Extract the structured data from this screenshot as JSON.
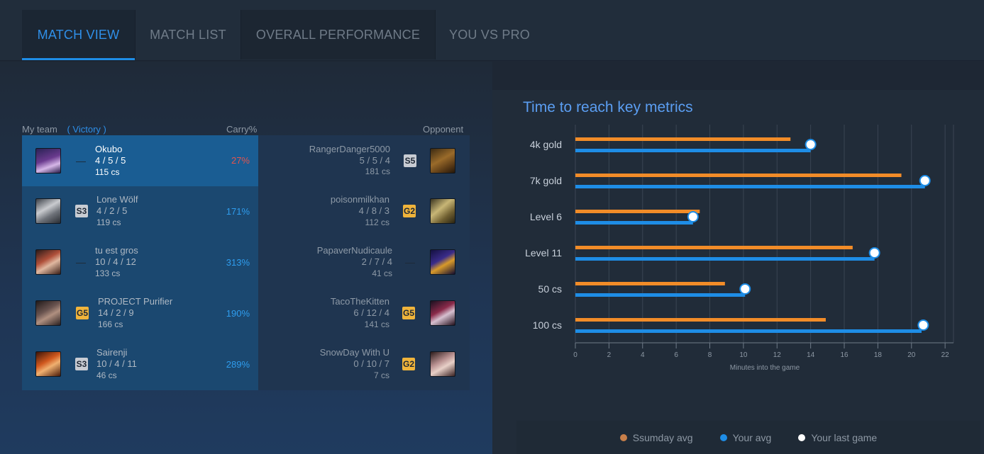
{
  "tabs": [
    {
      "label": "MATCH VIEW",
      "active": true
    },
    {
      "label": "MATCH LIST",
      "active": false
    },
    {
      "label": "OVERALL PERFORMANCE",
      "active": false
    },
    {
      "label": "YOU VS PRO",
      "active": false
    }
  ],
  "team": {
    "my_team_label": "My team",
    "result_label": "( Victory )",
    "carry_label": "Carry%",
    "opponent_label": "Opponent"
  },
  "rows": [
    {
      "me": {
        "name": "Okubo",
        "kda": "4 / 5 / 5",
        "cs": "115 cs",
        "rank": "—",
        "carry": "27%",
        "champion_icon": "champion-portrait-purple"
      },
      "opp": {
        "name": "RangerDanger5000",
        "kda": "5 / 5 / 4",
        "cs": "181 cs",
        "rank": "S5",
        "champion_icon": "champion-portrait-bronze"
      }
    },
    {
      "me": {
        "name": "Lone Wölf",
        "kda": "4 / 2 / 5",
        "cs": "119 cs",
        "rank": "S3",
        "carry": "171%",
        "champion_icon": "champion-portrait-white"
      },
      "opp": {
        "name": "poisonmilkhan",
        "kda": "4 / 8 / 3",
        "cs": "112 cs",
        "rank": "G2",
        "champion_icon": "champion-portrait-gold"
      }
    },
    {
      "me": {
        "name": "tu est gros",
        "kda": "10 / 4 / 12",
        "cs": "133 cs",
        "rank": "—",
        "carry": "313%",
        "champion_icon": "champion-portrait-red"
      },
      "opp": {
        "name": "PapaverNudicaule",
        "kda": "2 / 7 / 4",
        "cs": "41 cs",
        "rank": "—",
        "champion_icon": "champion-portrait-violet"
      }
    },
    {
      "me": {
        "name": "PROJECT Purifier",
        "kda": "14 / 2 / 9",
        "cs": "166 cs",
        "rank": "G5",
        "carry": "190%",
        "champion_icon": "champion-portrait-dark"
      },
      "opp": {
        "name": "TacoTheKitten",
        "kda": "6 / 12 / 4",
        "cs": "141 cs",
        "rank": "G5",
        "champion_icon": "champion-portrait-mask"
      }
    },
    {
      "me": {
        "name": "Sairenji",
        "kda": "10 / 4 / 11",
        "cs": "46 cs",
        "rank": "S3",
        "carry": "289%",
        "champion_icon": "champion-portrait-orange"
      },
      "opp": {
        "name": "SnowDay With U",
        "kda": "0 / 10 / 7",
        "cs": "7 cs",
        "rank": "G2",
        "champion_icon": "champion-portrait-pale"
      }
    }
  ],
  "chart": {
    "title": "Time to reach key metrics",
    "legend": [
      {
        "label": "Ssumday avg",
        "color": "#c87f4a"
      },
      {
        "label": "Your avg",
        "color": "#1e8de6"
      },
      {
        "label": "Your last game",
        "color": "#ffffff"
      }
    ]
  },
  "colors": {
    "accent": "#1e8de6",
    "orange": "#f28c28",
    "gold_rank": "#f0b43b",
    "silver_rank": "#c8ccd3",
    "carry_low": "#e5544d"
  },
  "chart_data": {
    "type": "bar",
    "orientation": "horizontal",
    "categories": [
      "4k gold",
      "7k gold",
      "Level 6",
      "Level 11",
      "50 cs",
      "100 cs"
    ],
    "series": [
      {
        "name": "Ssumday avg",
        "values": [
          12.8,
          19.4,
          7.4,
          16.5,
          8.9,
          14.9
        ]
      },
      {
        "name": "Your avg",
        "values": [
          14.0,
          20.8,
          7.0,
          17.8,
          10.1,
          20.6
        ]
      },
      {
        "name": "Your last game",
        "values": [
          14.0,
          20.8,
          7.0,
          17.8,
          10.1,
          20.7
        ]
      }
    ],
    "xlabel": "Minutes into the game",
    "ylabel": "",
    "xlim": [
      0,
      22.5
    ],
    "xticks": [
      0,
      2,
      4,
      6,
      8,
      10,
      12,
      14,
      16,
      18,
      20,
      22
    ],
    "grid": true,
    "legend_position": "bottom"
  }
}
